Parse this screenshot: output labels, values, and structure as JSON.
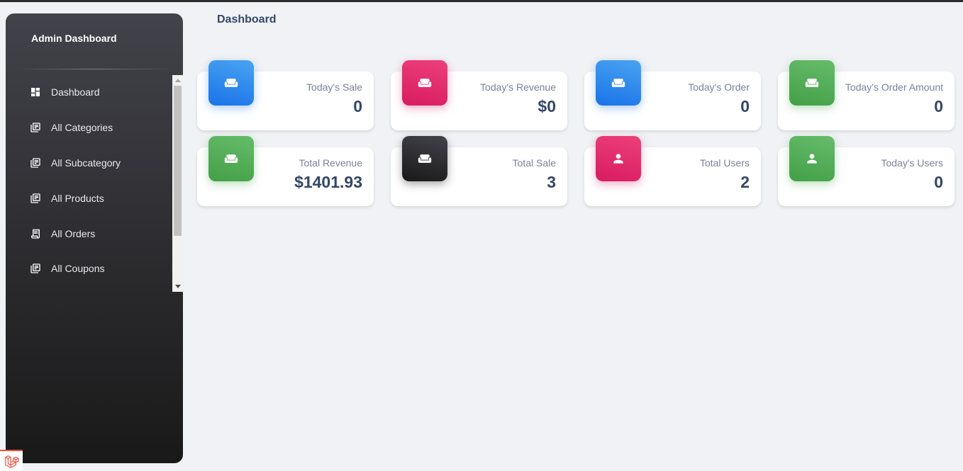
{
  "sidebar": {
    "brand": "Admin Dashboard",
    "items": [
      {
        "label": "Dashboard",
        "icon": "dashboard-icon"
      },
      {
        "label": "All Categories",
        "icon": "library-icon"
      },
      {
        "label": "All Subcategory",
        "icon": "library-icon"
      },
      {
        "label": "All Products",
        "icon": "library-icon"
      },
      {
        "label": "All Orders",
        "icon": "receipt-icon"
      },
      {
        "label": "All Coupons",
        "icon": "library-icon"
      }
    ]
  },
  "header": {
    "title": "Dashboard"
  },
  "cards": [
    {
      "label": "Today's Sale",
      "value": "0",
      "icon": "weekend-icon",
      "color": "#1a73e8"
    },
    {
      "label": "Today's Revenue",
      "value": "$0",
      "icon": "weekend-icon",
      "color": "#d81b60"
    },
    {
      "label": "Today's Order",
      "value": "0",
      "icon": "weekend-icon",
      "color": "#1a73e8"
    },
    {
      "label": "Today's Order Amount",
      "value": "0",
      "icon": "weekend-icon",
      "color": "#43a047"
    },
    {
      "label": "Total Revenue",
      "value": "$1401.93",
      "icon": "weekend-icon",
      "color": "#43a047"
    },
    {
      "label": "Total Sale",
      "value": "3",
      "icon": "weekend-icon",
      "color": "#191919"
    },
    {
      "label": "Total Users",
      "value": "2",
      "icon": "person-icon",
      "color": "#d81b60"
    },
    {
      "label": "Today's Users",
      "value": "0",
      "icon": "person-icon",
      "color": "#43a047"
    }
  ]
}
